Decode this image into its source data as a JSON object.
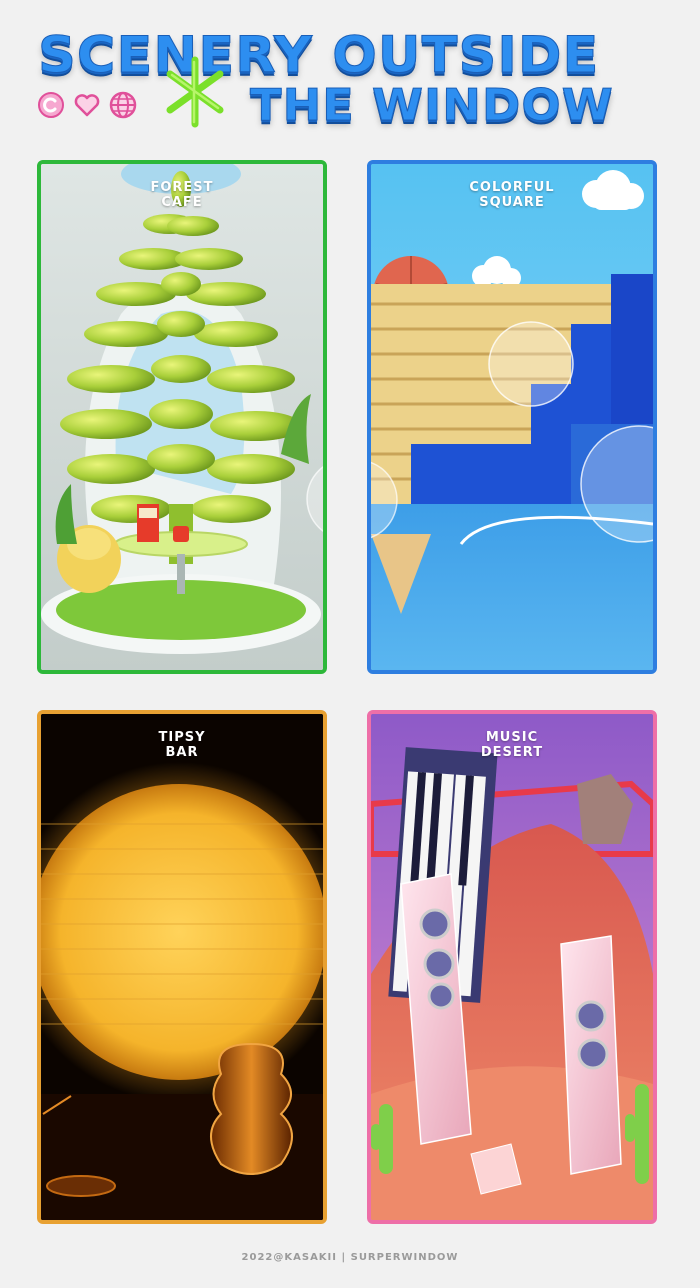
{
  "header": {
    "title_line1": "SCENERY OUTSIDE",
    "title_line2": "THE WINDOW",
    "icons": [
      "copyright-icon",
      "heart-icon",
      "globe-icon",
      "star-burst-icon"
    ]
  },
  "panels": [
    {
      "line1": "FOREST",
      "line2": "CAFE",
      "border": "#2db83a"
    },
    {
      "line1": "COLORFUL",
      "line2": "SQUARE",
      "border": "#2e7ee0"
    },
    {
      "line1": "TIPSY",
      "line2": "BAR",
      "border": "#e8a132"
    },
    {
      "line1": "MUSIC",
      "line2": "DESERT",
      "border": "#ee6fa8"
    }
  ],
  "footer": {
    "text": "2022@KASAKII | SURPERWINDOW"
  }
}
